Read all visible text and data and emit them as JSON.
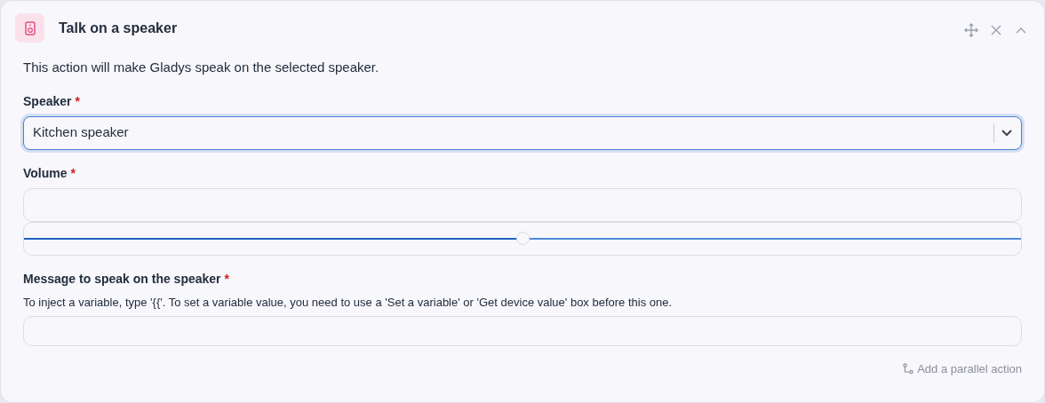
{
  "card": {
    "title": "Talk on a speaker",
    "description": "This action will make Gladys speak on the selected speaker."
  },
  "fields": [
    {
      "kind": "select",
      "label": "Speaker",
      "required_mark": "*",
      "value": "Kitchen speaker",
      "focused": true
    },
    {
      "kind": "volume",
      "label": "Volume",
      "required_mark": "*",
      "level": 0.5
    },
    {
      "kind": "text",
      "label": "Message to speak on the speaker",
      "required_mark": "*",
      "help": "To inject a variable, type '{{'. To set a variable value, you need to use a 'Set a variable' or 'Get device value' box before this one."
    }
  ],
  "footer": {
    "link": "Add a parallel action"
  }
}
